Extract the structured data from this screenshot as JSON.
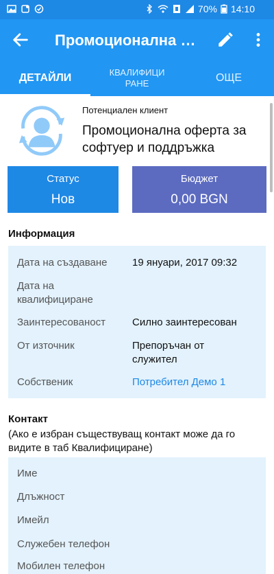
{
  "status_bar": {
    "battery": "70%",
    "time": "14:10"
  },
  "app_bar": {
    "title": "Промоционална о..."
  },
  "tabs": [
    {
      "label": "ДЕТАЙЛИ",
      "selected": true
    },
    {
      "label": "КВАЛИФИЦИРАНЕ",
      "selected": false
    },
    {
      "label": "ОЩЕ",
      "selected": false
    }
  ],
  "lead": {
    "type": "Потенциален клиент",
    "name": "Промоционална оферта за софтуер и поддръжка"
  },
  "cards": {
    "status_label": "Статус",
    "status_value": "Нов",
    "budget_label": "Бюджет",
    "budget_value": "0,00 BGN"
  },
  "info": {
    "title": "Информация",
    "rows": [
      {
        "label": "Дата на създаване",
        "value": "19 януари, 2017 09:32"
      },
      {
        "label": "Дата на квалифициране",
        "value": ""
      },
      {
        "label": "Заинтересованост",
        "value": "Силно заинтересован"
      },
      {
        "label": "От източник",
        "value": "Препоръчан от служител"
      },
      {
        "label": "Собственик",
        "value": "Потребител Демо 1"
      }
    ]
  },
  "contact": {
    "title": "Контакт",
    "note": "(Ако е избран съществуващ контакт може да го видите в таб Квалифициране)",
    "rows": [
      {
        "label": "Име"
      },
      {
        "label": "Длъжност"
      },
      {
        "label": "Имейл"
      },
      {
        "label": "Служебен телефон"
      },
      {
        "label": "Мобилен телефон"
      }
    ]
  },
  "colors": {
    "primary": "#2196f3",
    "status_card": "#1e88e5",
    "budget_card": "#5c6bc0",
    "info_bg": "#e3f2fd",
    "link": "#1e88e5"
  }
}
